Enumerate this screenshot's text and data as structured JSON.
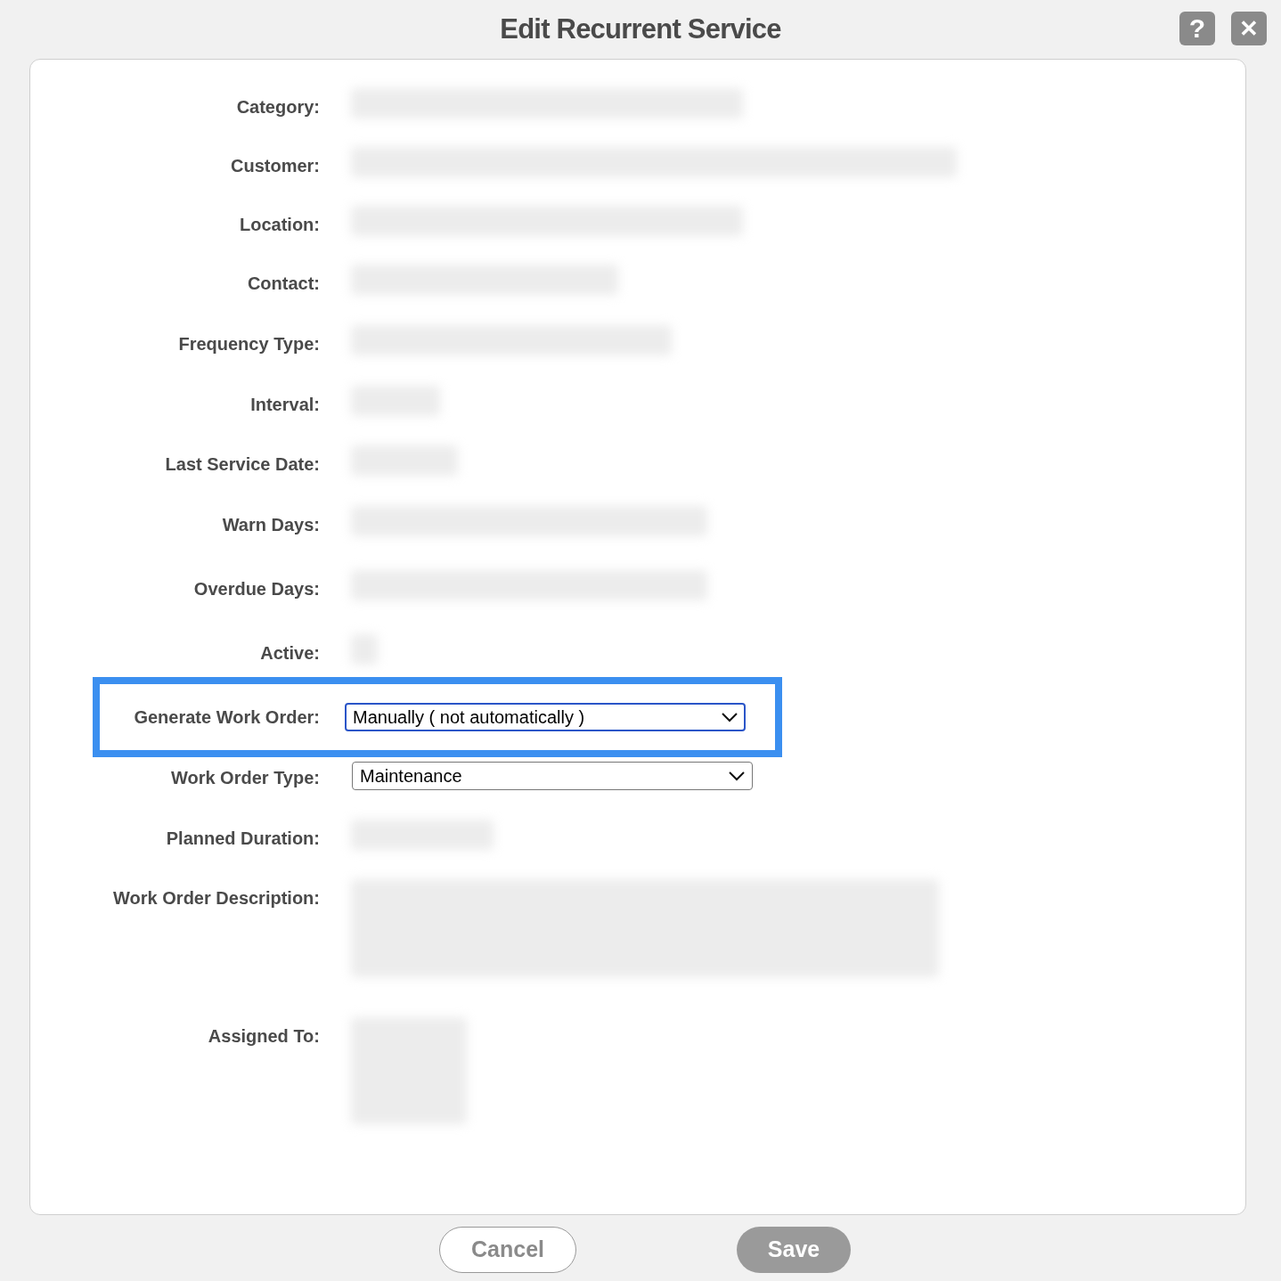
{
  "dialog": {
    "title": "Edit Recurrent Service",
    "help_icon": "?",
    "close_icon": "✕"
  },
  "fields": [
    {
      "label": "Category:",
      "kind": "blurred"
    },
    {
      "label": "Customer:",
      "kind": "blurred"
    },
    {
      "label": "Location:",
      "kind": "blurred"
    },
    {
      "label": "Contact:",
      "kind": "blurred"
    },
    {
      "label": "Frequency Type:",
      "kind": "blurred"
    },
    {
      "label": "Interval:",
      "kind": "blurred"
    },
    {
      "label": "Last Service Date:",
      "kind": "blurred"
    },
    {
      "label": "Warn Days:",
      "kind": "blurred"
    },
    {
      "label": "Overdue Days:",
      "kind": "blurred"
    },
    {
      "label": "Active:",
      "kind": "blurred"
    },
    {
      "label": "Generate Work Order:",
      "kind": "select",
      "value": "Manually ( not automatically )",
      "highlighted": true
    },
    {
      "label": "Work Order Type:",
      "kind": "select",
      "value": "Maintenance",
      "highlighted": false
    },
    {
      "label": "Planned Duration:",
      "kind": "blurred"
    },
    {
      "label": "Work Order Description:",
      "kind": "blurred"
    },
    {
      "label": "Assigned To:",
      "kind": "blurred"
    }
  ],
  "buttons": [
    {
      "label": "Cancel",
      "kind": "secondary"
    },
    {
      "label": "Save",
      "kind": "primary"
    }
  ]
}
